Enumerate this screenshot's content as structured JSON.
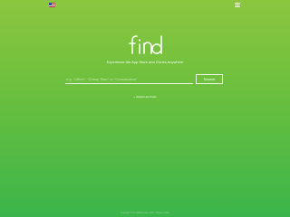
{
  "header": {
    "flag_icon": "us-flag-icon",
    "menu_icon": "hamburger-menu-icon"
  },
  "brand": {
    "logo_text": "find"
  },
  "tagline": "Experience the App Store and iTunes Anywhere",
  "search": {
    "value": "",
    "placeholder": "e.g. \"Office\", \"Chess Titan\" or \"Construction\"",
    "button_label": "Search"
  },
  "hint": "» Global Hot Posts",
  "footer": "Copyright © Fnd Mobile Dept. 2017 | Privacy Policy",
  "colors": {
    "gradient_top": "#8cc63f",
    "gradient_bottom": "#3bb54a",
    "text": "#ffffff"
  }
}
